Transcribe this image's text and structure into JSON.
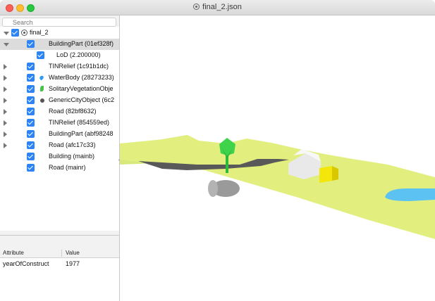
{
  "window": {
    "title": "final_2.json"
  },
  "search": {
    "placeholder": "Search"
  },
  "tree": {
    "root": {
      "label": "final_2"
    },
    "items": [
      {
        "label": "BuildingPart (01ef328f)",
        "selected": true,
        "expanded": true
      },
      {
        "label": "LoD (2.200000)"
      },
      {
        "label": "TINRelief (1c91b1dc)"
      },
      {
        "label": "WaterBody (28273233)",
        "icon": "water-drop-icon"
      },
      {
        "label": "SolitaryVegetationObje",
        "icon": "leaf-icon"
      },
      {
        "label": "GenericCityObject (6c2",
        "icon": "generic-object-icon"
      },
      {
        "label": "Road (82bf8632)"
      },
      {
        "label": "TINRelief (854559ed)"
      },
      {
        "label": "BuildingPart (abf98248"
      },
      {
        "label": "Road (afc17c33)"
      },
      {
        "label": "Building (mainb)"
      },
      {
        "label": "Road (mainr)"
      }
    ]
  },
  "attributes": {
    "headers": {
      "attribute": "Attribute",
      "value": "Value"
    },
    "rows": [
      {
        "attribute": "yearOfConstruct",
        "value": "1977"
      }
    ]
  },
  "viewport": {
    "colors": {
      "terrain": "#e2ef7f",
      "terrain_far": "#d7e97c",
      "road": "#595959",
      "tree_crown": "#3fd34a",
      "tree_trunk": "#2cbc3a",
      "building": "#e9e9e9",
      "building_part": "#f2e60a",
      "water": "#5cc2f1",
      "cylinder": "#9a9a9a"
    }
  }
}
